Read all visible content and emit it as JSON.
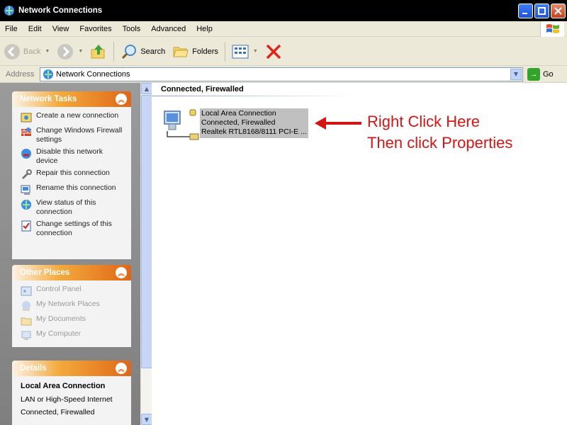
{
  "window": {
    "title": "Network Connections"
  },
  "menu": [
    "File",
    "Edit",
    "View",
    "Favorites",
    "Tools",
    "Advanced",
    "Help"
  ],
  "toolbar": {
    "back": "Back",
    "search": "Search",
    "folders": "Folders"
  },
  "address": {
    "label": "Address",
    "value": "Network Connections",
    "go": "Go"
  },
  "network_tasks": {
    "title": "Network Tasks",
    "items": [
      {
        "label": "Create a new connection",
        "icon": "new-connection-icon"
      },
      {
        "label": "Change Windows Firewall settings",
        "icon": "firewall-icon"
      },
      {
        "label": "Disable this network device",
        "icon": "disable-network-icon"
      },
      {
        "label": "Repair this connection",
        "icon": "repair-icon"
      },
      {
        "label": "Rename this connection",
        "icon": "rename-icon"
      },
      {
        "label": "View status of this connection",
        "icon": "status-icon"
      },
      {
        "label": "Change settings of this connection",
        "icon": "settings-icon"
      }
    ]
  },
  "other_places": {
    "title": "Other Places",
    "items": [
      {
        "label": "Control Panel",
        "icon": "control-panel-icon"
      },
      {
        "label": "My Network Places",
        "icon": "network-places-icon"
      },
      {
        "label": "My Documents",
        "icon": "documents-folder-icon"
      },
      {
        "label": "My Computer",
        "icon": "computer-icon"
      }
    ]
  },
  "details": {
    "title": "Details",
    "name": "Local Area Connection",
    "type": "LAN or High-Speed Internet",
    "status": "Connected, Firewalled"
  },
  "main": {
    "group_header": "Connected, Firewalled",
    "connection": {
      "name": "Local Area Connection",
      "status": "Connected, Firewalled",
      "device": "Realtek RTL8168/8111 PCI-E ..."
    }
  },
  "annotation": {
    "line1": "Right Click Here",
    "line2": "Then click Properties",
    "color": "#d61414"
  }
}
